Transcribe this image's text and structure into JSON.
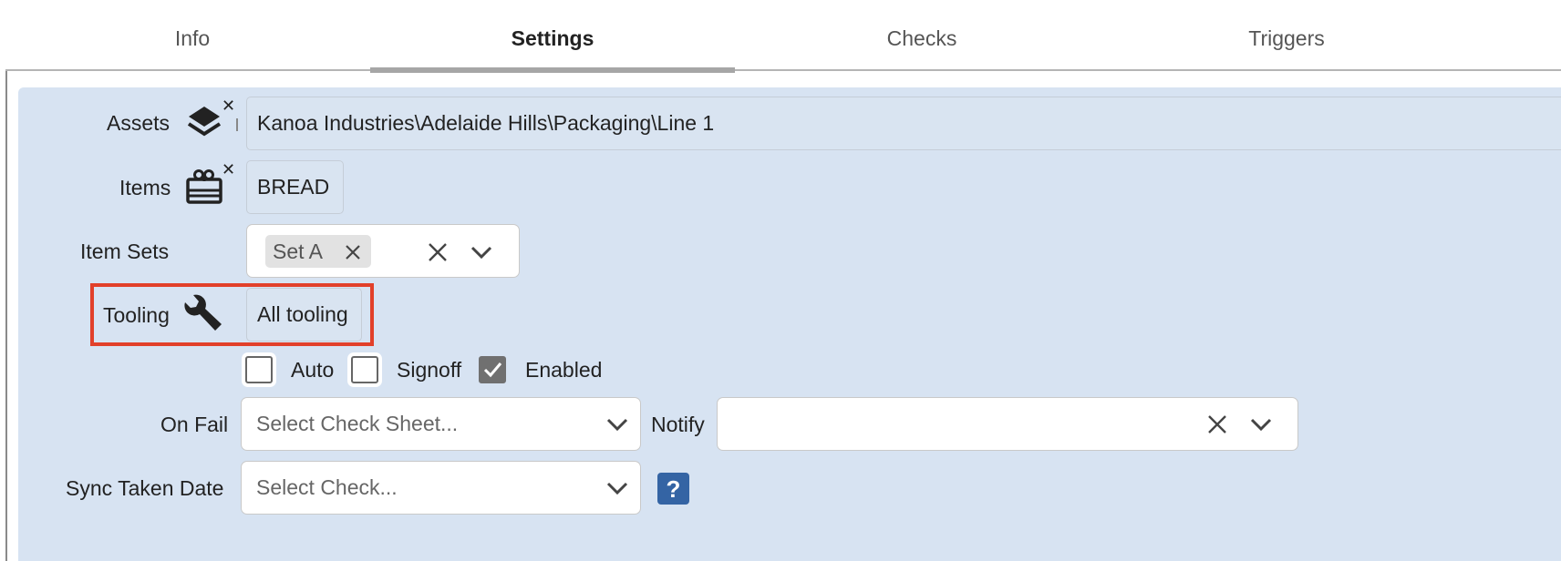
{
  "tabs": [
    {
      "label": "Info"
    },
    {
      "label": "Settings",
      "active": true
    },
    {
      "label": "Checks"
    },
    {
      "label": "Triggers"
    }
  ],
  "form": {
    "assets": {
      "label": "Assets",
      "value": "Kanoa Industries\\Adelaide Hills\\Packaging\\Line 1",
      "icon": "layers-icon"
    },
    "items": {
      "label": "Items",
      "value": "BREAD",
      "icon": "gift-box-icon"
    },
    "item_sets": {
      "label": "Item Sets",
      "chips": [
        "Set A"
      ]
    },
    "tooling": {
      "label": "Tooling",
      "value": "All tooling",
      "icon": "wrench-icon"
    },
    "checkboxes": [
      {
        "label": "Auto",
        "checked": false
      },
      {
        "label": "Signoff",
        "checked": false
      },
      {
        "label": "Enabled",
        "checked": true
      }
    ],
    "on_fail": {
      "label": "On Fail",
      "placeholder": "Select Check Sheet..."
    },
    "notify": {
      "label": "Notify",
      "value": ""
    },
    "sync_taken_date": {
      "label": "Sync Taken Date",
      "placeholder": "Select Check..."
    },
    "help": {
      "glyph": "?"
    }
  },
  "colors": {
    "panel_bg": "#d7e3f2",
    "highlight": "#e2402a",
    "help_button": "#3464a4"
  }
}
